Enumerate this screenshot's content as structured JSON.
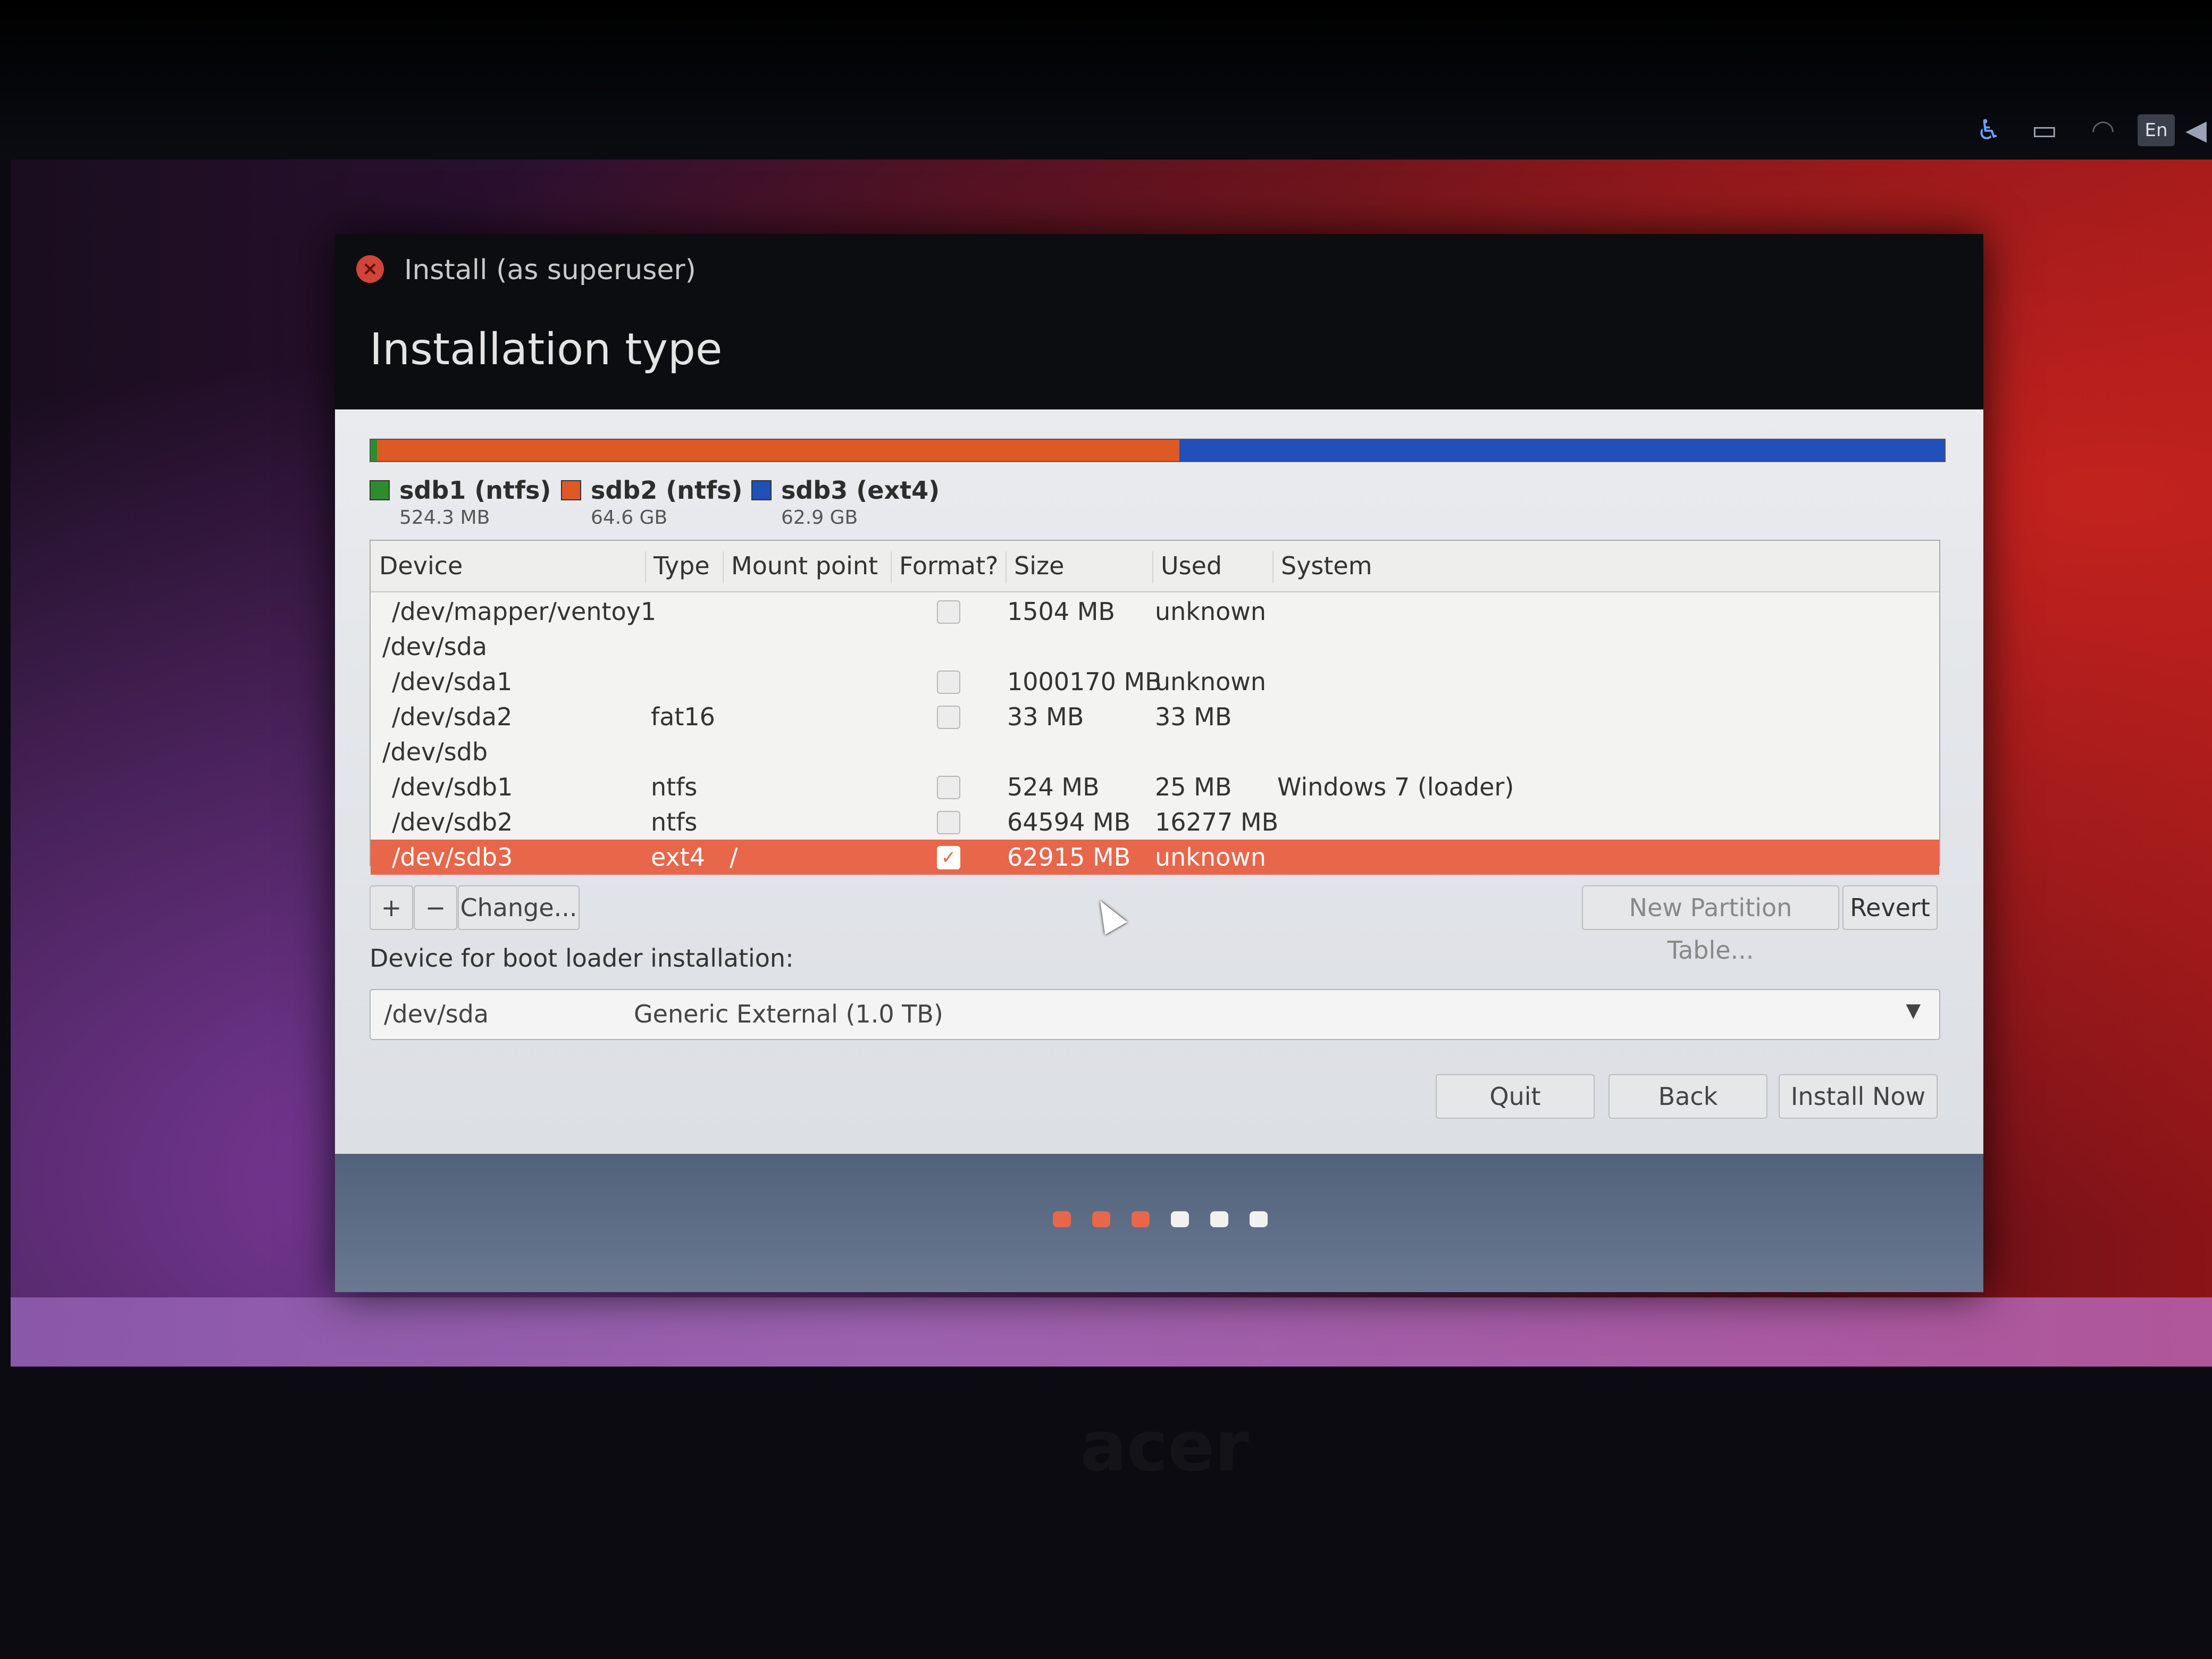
{
  "window": {
    "title": "Install (as superuser)",
    "close_icon": "close-icon",
    "heading": "Installation type"
  },
  "partition_bar": {
    "segments": [
      {
        "name": "sdb1 (ntfs)",
        "color": "#2e8b2e",
        "fraction": 0.004
      },
      {
        "name": "sdb2 (ntfs)",
        "color": "#dd5a24",
        "fraction": 0.51
      },
      {
        "name": "sdb3 (ext4)",
        "color": "#2050b8",
        "fraction": 0.486
      }
    ]
  },
  "legend": [
    {
      "name": "sdb1 (ntfs)",
      "size": "524.3 MB",
      "color": "#2e8b2e"
    },
    {
      "name": "sdb2 (ntfs)",
      "size": "64.6 GB",
      "color": "#dd5a24"
    },
    {
      "name": "sdb3 (ext4)",
      "size": "62.9 GB",
      "color": "#2050b8"
    }
  ],
  "table": {
    "columns": [
      "Device",
      "Type",
      "Mount point",
      "Format?",
      "Size",
      "Used",
      "System"
    ],
    "rows": [
      {
        "device": "/dev/mapper/ventoy1",
        "type": "",
        "mount": "",
        "format": "unchecked",
        "size": "1504 MB",
        "used": "unknown",
        "system": "",
        "indent": true
      },
      {
        "device": "/dev/sda",
        "type": "",
        "mount": "",
        "format": "",
        "size": "",
        "used": "",
        "system": "",
        "indent": false
      },
      {
        "device": "/dev/sda1",
        "type": "",
        "mount": "",
        "format": "unchecked",
        "size": "1000170 MB",
        "used": "unknown",
        "system": "",
        "indent": true
      },
      {
        "device": "/dev/sda2",
        "type": "fat16",
        "mount": "",
        "format": "unchecked",
        "size": "33 MB",
        "used": "33 MB",
        "system": "",
        "indent": true
      },
      {
        "device": "/dev/sdb",
        "type": "",
        "mount": "",
        "format": "",
        "size": "",
        "used": "",
        "system": "",
        "indent": false
      },
      {
        "device": "/dev/sdb1",
        "type": "ntfs",
        "mount": "",
        "format": "unchecked",
        "size": "524 MB",
        "used": "25 MB",
        "system": "Windows 7 (loader)",
        "indent": true
      },
      {
        "device": "/dev/sdb2",
        "type": "ntfs",
        "mount": "",
        "format": "unchecked",
        "size": "64594 MB",
        "used": "16277 MB",
        "system": "",
        "indent": true
      },
      {
        "device": "/dev/sdb3",
        "type": "ext4",
        "mount": "/",
        "format": "checked",
        "size": "62915 MB",
        "used": "unknown",
        "system": "",
        "indent": true,
        "selected": true
      }
    ]
  },
  "toolbar": {
    "add_label": "+",
    "remove_label": "−",
    "change_label": "Change...",
    "new_table_label": "New Partition Table...",
    "revert_label": "Revert"
  },
  "bootloader": {
    "label": "Device for boot loader installation:",
    "device": "/dev/sda",
    "description": "Generic External (1.0 TB)"
  },
  "nav": {
    "quit_label": "Quit",
    "back_label": "Back",
    "install_label": "Install Now"
  },
  "progress": {
    "total_steps": 6,
    "completed_steps": 3,
    "active_color": "#e8664a",
    "inactive_color": "#f1f1f1"
  },
  "tray": {
    "keyboard": "En"
  },
  "brand": "acer",
  "colors": {
    "selection": "#e8664a"
  }
}
